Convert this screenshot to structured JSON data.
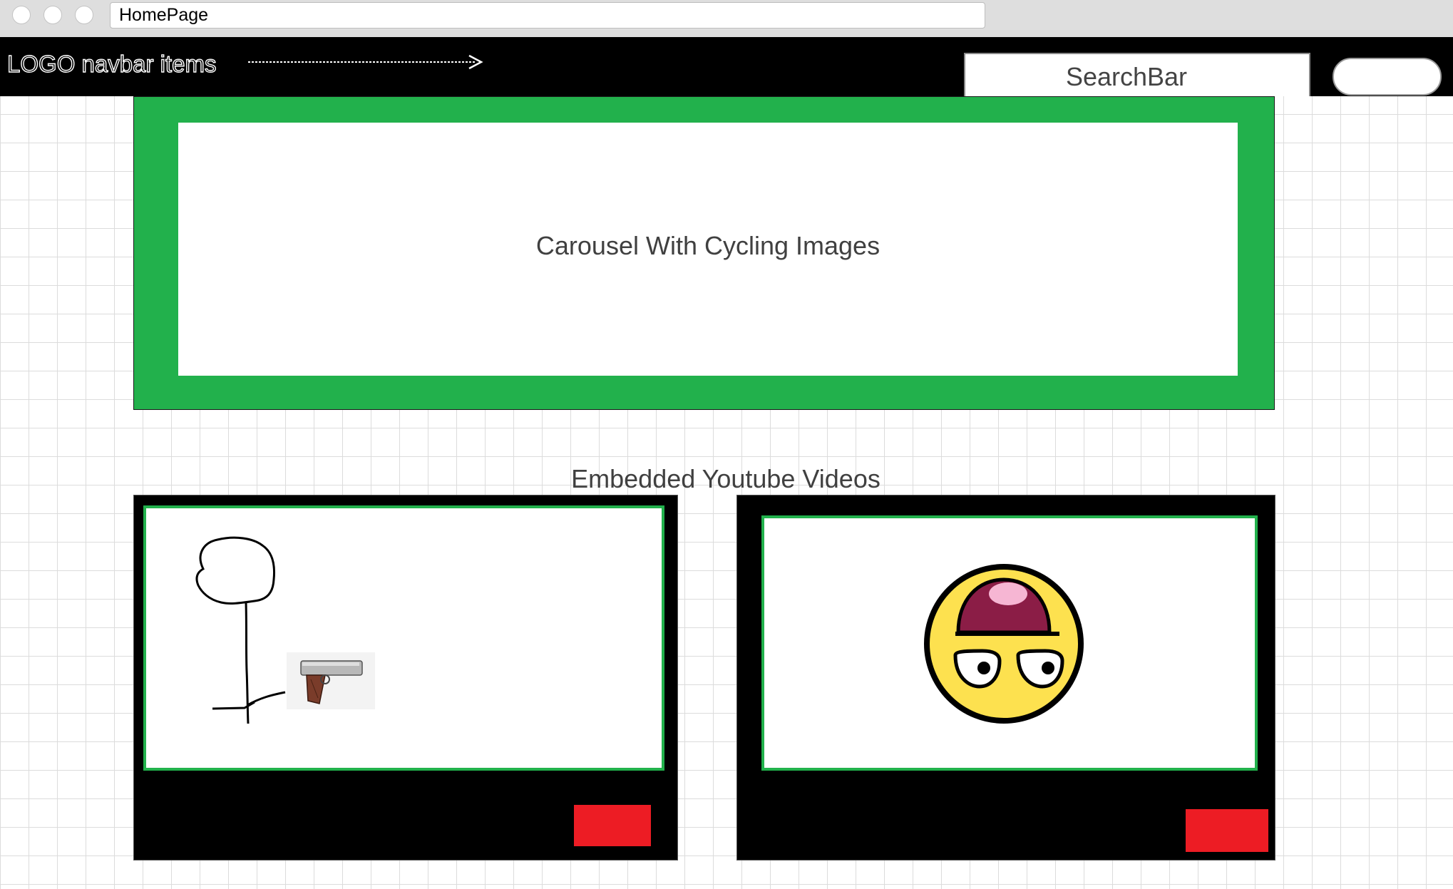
{
  "window": {
    "address_text": "HomePage"
  },
  "navbar": {
    "nav_text": "LOGO navbar items",
    "search_label": "SearchBar",
    "arrow_icon": "dashed-arrow-icon"
  },
  "carousel": {
    "label": "Carousel With Cycling Images",
    "accent_color": "#22b14c"
  },
  "videos": {
    "section_title": "Embedded Youtube Videos",
    "items": [
      {
        "thumbnail": "stick-figure-with-pistol-drawing"
      },
      {
        "thumbnail": "awesome-smiley-face"
      }
    ],
    "button_color": "#ed1c24"
  },
  "colors": {
    "navbar": "#000000",
    "card_border": "#22b14c",
    "play_button": "#ed1c24"
  }
}
